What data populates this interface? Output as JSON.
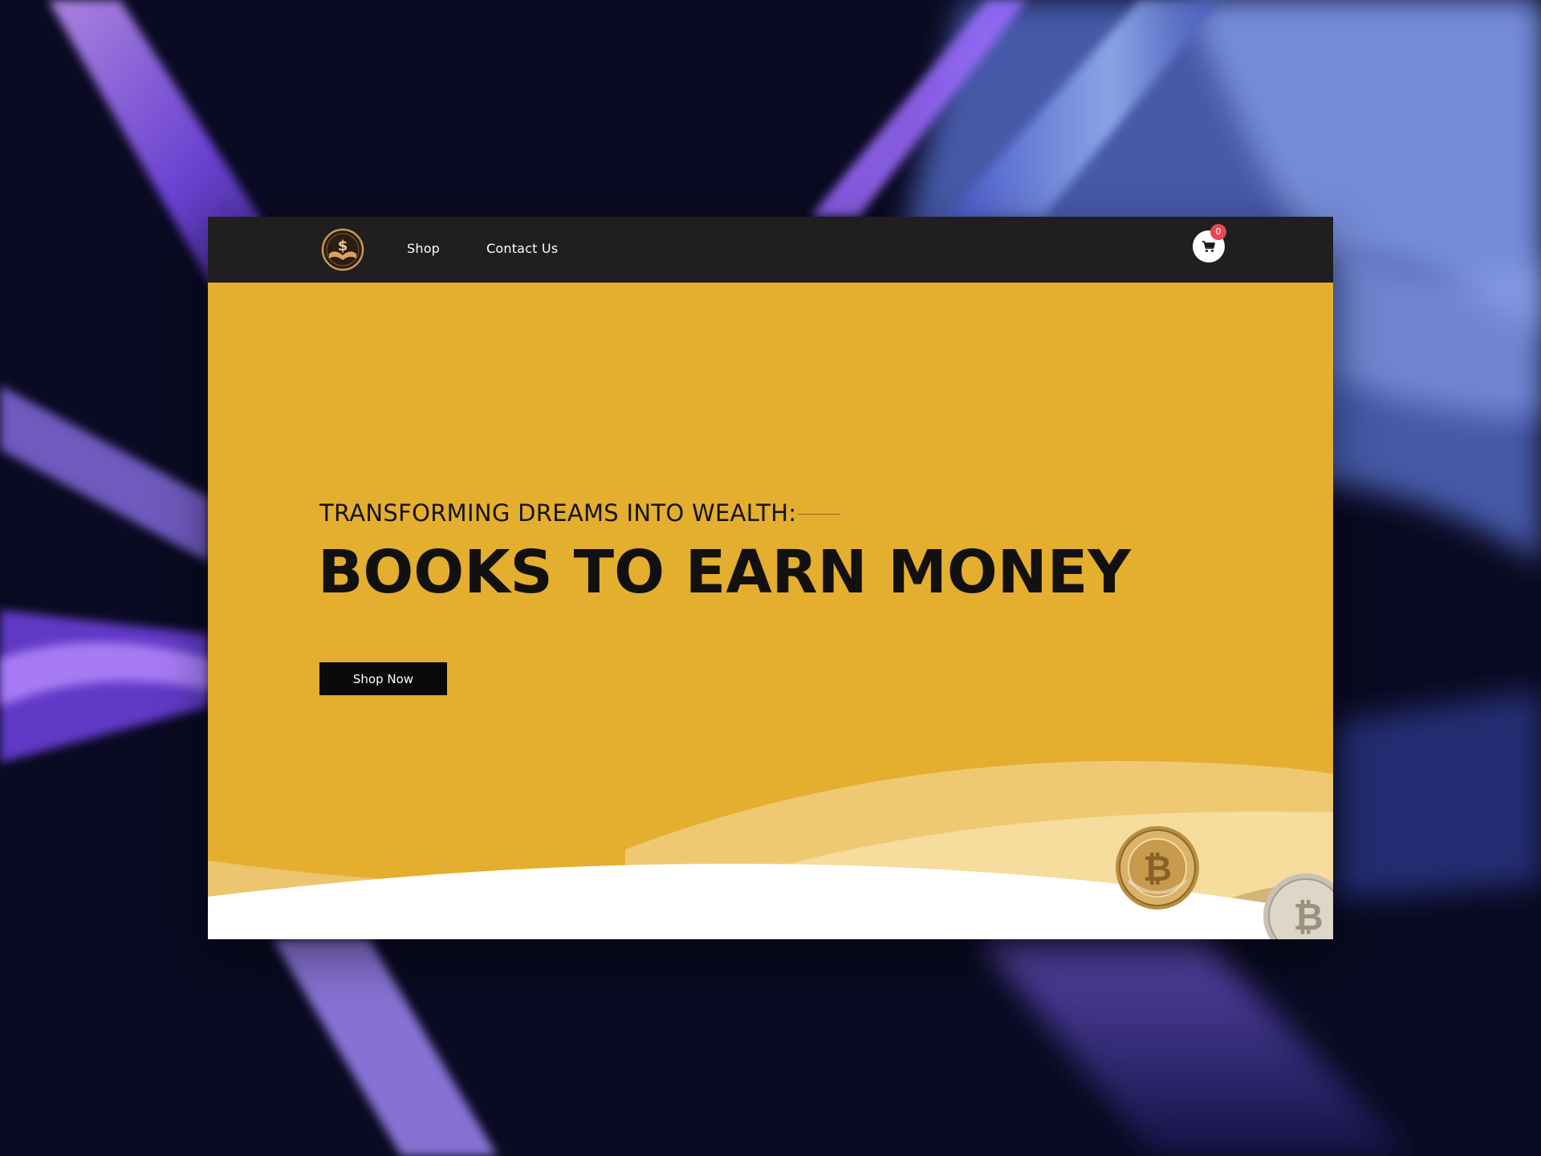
{
  "nav": {
    "links": [
      {
        "label": "Shop"
      },
      {
        "label": "Contact Us"
      }
    ],
    "cart_count": "0"
  },
  "hero": {
    "subtitle": "TRANSFORMING DREAMS INTO WEALTH:",
    "title": "BOOKS TO EARN MONEY",
    "cta_label": "Shop Now"
  },
  "icons": {
    "logo": "dollar-book-logo-icon",
    "cart": "shopping-cart-icon",
    "coin": "bitcoin-coin-icon"
  },
  "colors": {
    "navbar": "#201e1e",
    "hero_background": "#e4ae2f",
    "button": "#0b0a0a",
    "badge": "#e84855"
  }
}
